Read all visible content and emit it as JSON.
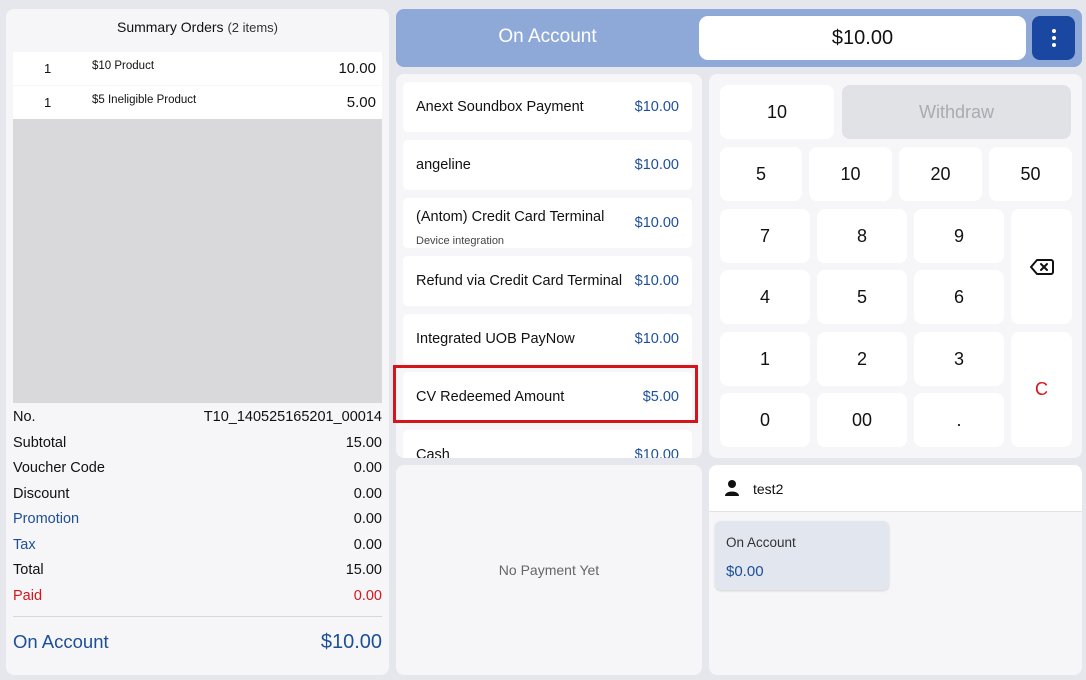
{
  "summary": {
    "title": "Summary Orders",
    "count": "(2 items)",
    "items": [
      {
        "qty": "1",
        "name": "$10 Product",
        "amount": "10.00"
      },
      {
        "qty": "1",
        "name": "$5 Ineligible Product",
        "amount": "5.00"
      }
    ],
    "lines": [
      {
        "label": "No.",
        "value": "T10_140525165201_00014"
      },
      {
        "label": "Subtotal",
        "value": "15.00"
      },
      {
        "label": "Voucher Code",
        "value": "0.00"
      },
      {
        "label": "Discount",
        "value": "0.00"
      },
      {
        "label": "Promotion",
        "value": "0.00"
      },
      {
        "label": "Tax",
        "value": "0.00"
      },
      {
        "label": "Total",
        "value": "15.00"
      },
      {
        "label": "Paid",
        "value": "0.00"
      }
    ],
    "total_label": "On Account",
    "total_value": "$10.00"
  },
  "header": {
    "title": "On Account",
    "amount": "$10.00",
    "menu_icon": "kebab-menu-icon"
  },
  "methods": [
    {
      "name": "Anext Soundbox Payment",
      "amount": "$10.00"
    },
    {
      "name": "angeline",
      "amount": "$10.00"
    },
    {
      "name": "(Antom) Credit Card Terminal",
      "sub": "Device integration",
      "amount": "$10.00"
    },
    {
      "name": "Refund via Credit Card Terminal",
      "amount": "$10.00"
    },
    {
      "name": "Integrated UOB PayNow",
      "amount": "$10.00"
    },
    {
      "name": "CV Redeemed Amount",
      "amount": "$5.00"
    },
    {
      "name": "Cash",
      "amount": "$10.00"
    }
  ],
  "keypad": {
    "display": "10",
    "withdraw": "Withdraw",
    "quick": [
      "5",
      "10",
      "20",
      "50"
    ],
    "digits": [
      "7",
      "8",
      "9",
      "4",
      "5",
      "6",
      "1",
      "2",
      "3",
      "0",
      "00",
      "."
    ],
    "backspace_icon": "backspace-icon",
    "clear": "C"
  },
  "payments": {
    "empty": "No Payment Yet"
  },
  "customer": {
    "name": "test2",
    "icon": "user-icon",
    "account_label": "On Account",
    "account_value": "$0.00"
  },
  "colors": {
    "accent": "#1a47a2",
    "header_bg": "#8ea9d8",
    "blue_text": "#1d4f99",
    "red_text": "#d4161c",
    "highlight": "#d4161c"
  }
}
